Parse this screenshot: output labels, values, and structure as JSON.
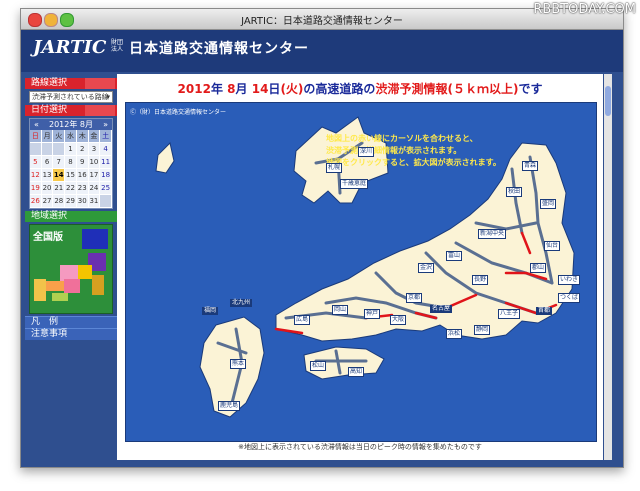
{
  "window": {
    "title": "JARTIC：日本道路交通情報センター"
  },
  "watermark": "RBBTODAY.COM",
  "header": {
    "logo": "JARTIC",
    "org_prefix": "財団法人",
    "site_title": "日本道路交通情報センター"
  },
  "sidebar": {
    "route_label": "路線選択",
    "route_select_value": "渋滞予測されている路線",
    "date_label": "日付選択",
    "calendar": {
      "month_label": "2012年 8月",
      "prev": "«",
      "next": "»",
      "weekdays": [
        "日",
        "月",
        "火",
        "水",
        "木",
        "金",
        "土"
      ],
      "weeks": [
        [
          "",
          "",
          "",
          "1",
          "2",
          "3",
          "4"
        ],
        [
          "5",
          "6",
          "7",
          "8",
          "9",
          "10",
          "11"
        ],
        [
          "12",
          "13",
          "14",
          "15",
          "16",
          "17",
          "18"
        ],
        [
          "19",
          "20",
          "21",
          "22",
          "23",
          "24",
          "25"
        ],
        [
          "26",
          "27",
          "28",
          "29",
          "30",
          "31",
          ""
        ]
      ],
      "selected": "14"
    },
    "region_label": "地域選択",
    "region_all": "全国版",
    "legend_label": "凡　例",
    "notice_label": "注意事項"
  },
  "main": {
    "headline": {
      "year": "2012",
      "y": "年",
      "month": "8",
      "m": "月",
      "day": "14",
      "d": "日",
      "dow": "(火)",
      "mid": "の高速道路の",
      "tag": "渋滞予測情報",
      "cond": "(５ｋｍ以上)",
      "end": "です"
    },
    "copyright": "Ⓒ（財）日本道路交通情報センター",
    "notes": [
      "地図上の赤い線にカーソルを合わせると、",
      "渋滞予測の詳細情報が表示されます。",
      "地図をクリックすると、拡大図が表示されます。"
    ],
    "footer": "※地図上に表示されている渋滞情報は当日のピーク時の情報を集めたものです",
    "map_labels": {
      "sapporo": "札幌",
      "fukagawa": "深川",
      "chitose": "千歳恵庭",
      "aomori": "青森",
      "akita": "秋田",
      "morioka": "盛岡",
      "sendai": "仙台",
      "niigata": "新潟中央",
      "koriyama": "郡山",
      "iwaki": "いわき",
      "tsukuba": "つくば",
      "tokyo": "首都",
      "hachioji": "八王子",
      "nagoya": "名古屋",
      "osaka": "大阪",
      "kobe": "神戸",
      "okayama": "岡山",
      "hiroshima": "広島",
      "fukuoka": "福岡",
      "kitakyushu": "北九州",
      "kumamoto": "熊本",
      "kagoshima": "鹿児島",
      "matsuyama": "松山",
      "kochi": "高知",
      "kanazawa": "金沢",
      "toyama": "富山",
      "nagano": "長野",
      "shizuoka": "静岡",
      "hamamatsu": "浜松",
      "kyoto": "京都"
    }
  }
}
